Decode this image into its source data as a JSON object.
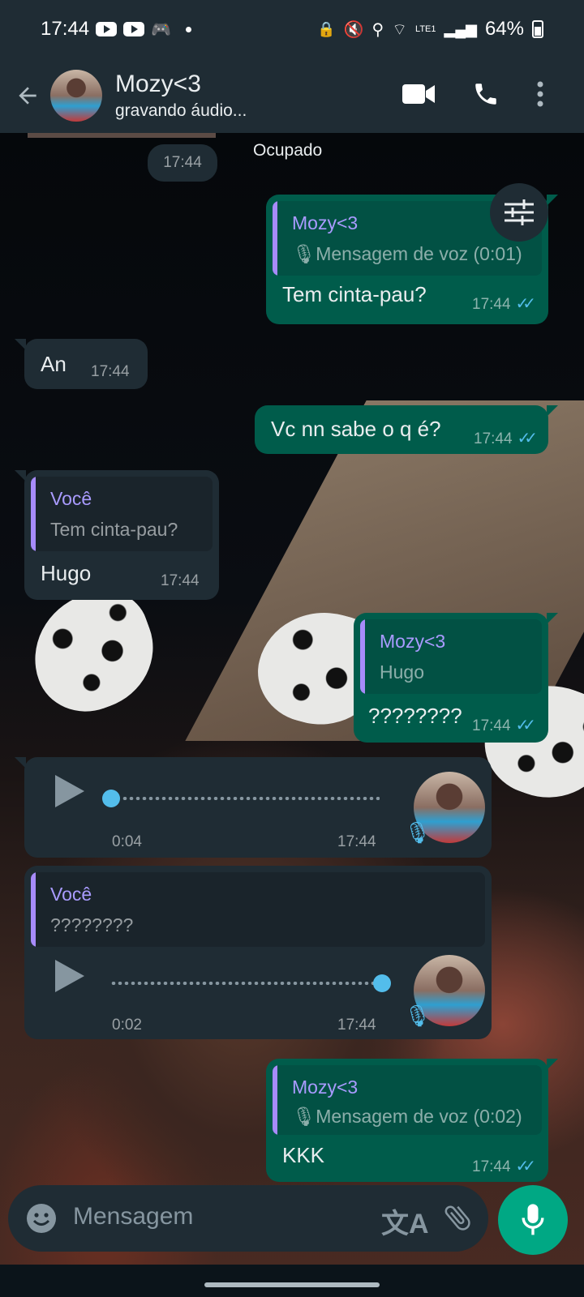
{
  "status_bar": {
    "time": "17:44",
    "battery": "64%",
    "lte": "LTE1"
  },
  "header": {
    "contact_name": "Mozy<3",
    "status": "gravando áudio..."
  },
  "system": {
    "occupied": "Ocupado",
    "time_chip": "17:44"
  },
  "messages": [
    {
      "dir": "out",
      "quote_name": "Mozy<3",
      "quote_text": "Mensagem de voz (0:01)",
      "text": "Tem cinta-pau?",
      "time": "17:44"
    },
    {
      "dir": "in",
      "text": "An",
      "time": "17:44"
    },
    {
      "dir": "out",
      "text": "Vc nn sabe o q é?",
      "time": "17:44"
    },
    {
      "dir": "in",
      "quote_name": "Você",
      "quote_text": "Tem cinta-pau?",
      "text": "Hugo",
      "time": "17:44"
    },
    {
      "dir": "out",
      "quote_name": "Mozy<3",
      "quote_text": "Hugo",
      "text": "????????",
      "time": "17:44"
    },
    {
      "dir": "in",
      "voice_duration": "0:04",
      "time": "17:44",
      "progress": 0.0
    },
    {
      "dir": "in",
      "quote_name": "Você",
      "quote_text": "????????",
      "voice_duration": "0:02",
      "time": "17:44",
      "progress": 1.0
    },
    {
      "dir": "out",
      "quote_name": "Mozy<3",
      "quote_text": "Mensagem de voz (0:02)",
      "text": "KKK",
      "time": "17:44"
    }
  ],
  "input": {
    "placeholder": "Mensagem"
  },
  "icons": {
    "back": "arrow-left-icon",
    "video": "video-camera-icon",
    "call": "phone-icon",
    "menu": "more-vertical-icon",
    "emoji": "emoji-icon",
    "translate": "translate-icon",
    "attach": "paperclip-icon",
    "mic": "microphone-icon",
    "filter": "sliders-icon"
  },
  "colors": {
    "outgoing": "#005c4b",
    "incoming": "#1f2c34",
    "accent": "#00a884",
    "read_ticks": "#53bdeb",
    "quote_name": "#a99bff"
  }
}
